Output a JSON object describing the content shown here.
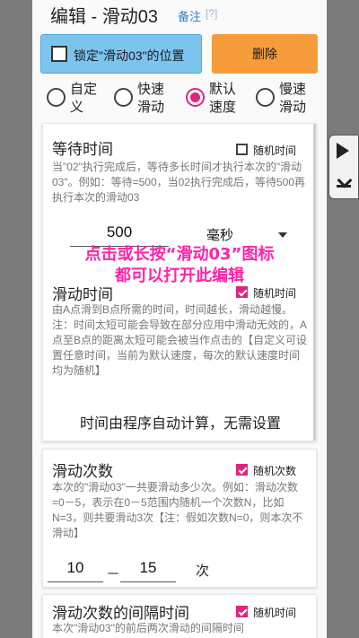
{
  "title": "编辑 - 滑动03",
  "title_note": "备注",
  "title_help": "[?]",
  "lock_button": "锁定\"滑动03\"的位置",
  "delete_button": "删除",
  "speed_options": [
    {
      "label": "自定义"
    },
    {
      "label": "快速滑动"
    },
    {
      "label": "默认速度",
      "selected": true
    },
    {
      "label": "慢速滑动"
    }
  ],
  "wait": {
    "title": "等待时间",
    "random_label": "随机时间",
    "random_checked": false,
    "desc": "当\"02\"执行完成后，等待多长时间才执行本次的\"滑动03\"。例如：等待=500，当02执行完成后，等待500再执行本次的滑动03",
    "value": "500",
    "unit": "毫秒"
  },
  "slide_time": {
    "title": "滑动时间",
    "random_label": "随机时间",
    "random_checked": true,
    "desc": "由A点滑到B点所需的时间，时间越长，滑动越慢。注：时间太短可能会导致在部分应用中滑动无效的，A点至B点的距离太短可能会被当作点击的【自定义可设置任意时间，当前为默认速度，每次的默认速度时间均为随机】",
    "auto_note": "时间由程序自动计算，无需设置"
  },
  "slide_count": {
    "title": "滑动次数",
    "random_label": "随机次数",
    "random_checked": true,
    "desc": "本次的\"滑动03\"一共要滑动多少次。例如：滑动次数=0－5，表示在0－5范围内随机一个次数N，比如N=3，则共要滑动3次【注：假如次数N=0，则本次不滑动】",
    "min": "10",
    "separator": "－",
    "max": "15",
    "unit": "次"
  },
  "interval": {
    "title": "滑动次数的间隔时间",
    "random_label": "随机时间",
    "random_checked": true,
    "desc": "本次\"滑动03\"的前后两次滑动的间隔时间"
  },
  "overlay_lines": [
    "点击或长按“滑动03”图标",
    "都可以打开此编辑"
  ],
  "colors": {
    "accent": "#e0267a",
    "lock_btn": "#7cc4ee",
    "delete_btn": "#f79c3a",
    "overlay_text": "#ff23a7"
  }
}
